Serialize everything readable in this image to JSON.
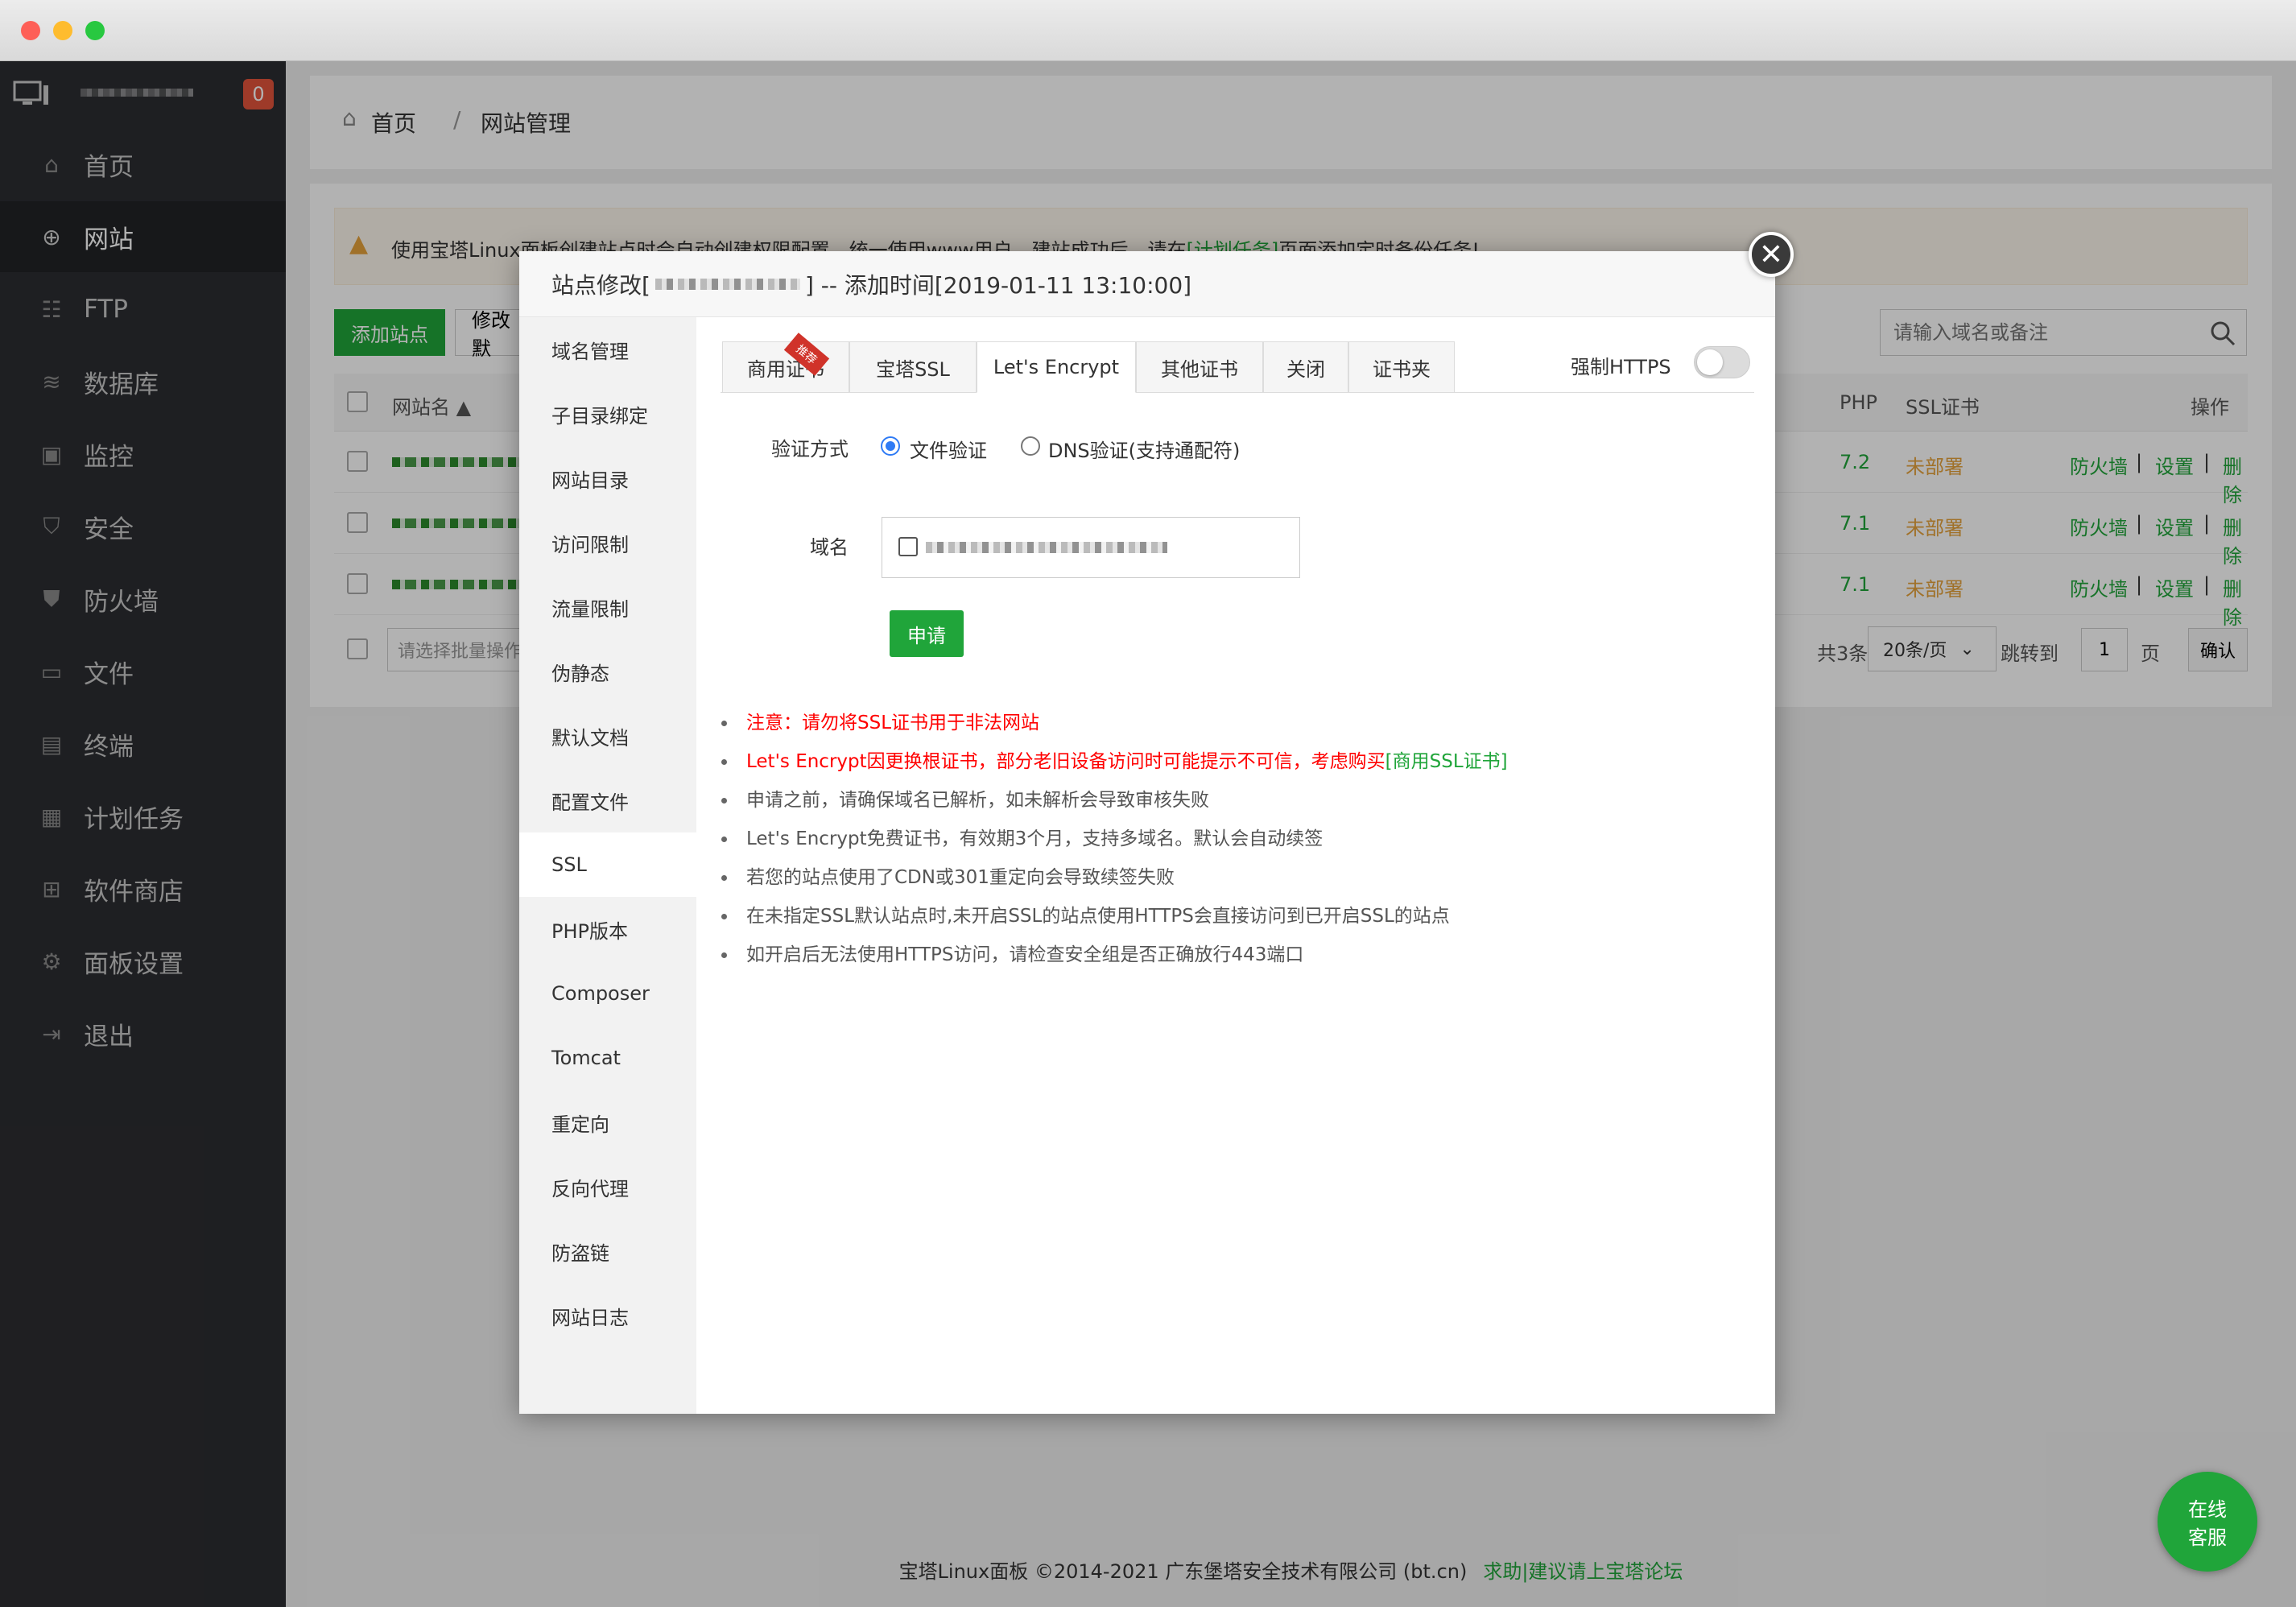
{
  "breadcrumb": {
    "home": "首页",
    "sep": "/",
    "current": "网站管理"
  },
  "sidebar": {
    "badge": "0",
    "items": [
      {
        "label": "首页",
        "icon": "home-icon"
      },
      {
        "label": "网站",
        "icon": "globe-icon"
      },
      {
        "label": "FTP",
        "icon": "ftp-icon"
      },
      {
        "label": "数据库",
        "icon": "database-icon"
      },
      {
        "label": "监控",
        "icon": "monitor-icon"
      },
      {
        "label": "安全",
        "icon": "shield-icon"
      },
      {
        "label": "防火墙",
        "icon": "firewall-icon"
      },
      {
        "label": "文件",
        "icon": "folder-icon"
      },
      {
        "label": "终端",
        "icon": "terminal-icon"
      },
      {
        "label": "计划任务",
        "icon": "calendar-icon"
      },
      {
        "label": "软件商店",
        "icon": "apps-icon"
      },
      {
        "label": "面板设置",
        "icon": "gear-icon"
      },
      {
        "label": "退出",
        "icon": "logout-icon"
      }
    ]
  },
  "warning": {
    "text": "使用宝塔Linux面板创建站点时会自动创建权限配置，统一使用www用户。建站成功后，请在",
    "link": "[计划任务]",
    "tail": "页面添加定时备份任务!"
  },
  "toolbar": {
    "add_site": "添加站点",
    "modify": "修改默",
    "search_placeholder": "请输入域名或备注"
  },
  "table": {
    "headers": {
      "name": "网站名",
      "php": "PHP",
      "ssl": "SSL证书",
      "ops": "操作"
    },
    "rows": [
      {
        "php": "7.2",
        "ssl": "未部署",
        "firewall": "防火墙",
        "settings": "设置",
        "delete": "删除"
      },
      {
        "php": "7.1",
        "ssl": "未部署",
        "firewall": "防火墙",
        "settings": "设置",
        "delete": "删除"
      },
      {
        "php": "7.1",
        "ssl": "未部署",
        "firewall": "防火墙",
        "settings": "设置",
        "delete": "删除"
      }
    ],
    "batch_placeholder": "请选择批量操作",
    "total": "共3条",
    "page_size": "20条/页",
    "jump_label": "跳转到",
    "jump_value": "1",
    "page_unit": "页",
    "confirm": "确认"
  },
  "modal": {
    "title_prefix": "站点修改[",
    "title_suffix": "] -- 添加时间[2019-01-11 13:10:00]",
    "nav": [
      "域名管理",
      "子目录绑定",
      "网站目录",
      "访问限制",
      "流量限制",
      "伪静态",
      "默认文档",
      "配置文件",
      "SSL",
      "PHP版本",
      "Composer",
      "Tomcat",
      "重定向",
      "反向代理",
      "防盗链",
      "网站日志"
    ],
    "tabs": [
      "商用证书",
      "宝塔SSL",
      "Let's Encrypt",
      "其他证书",
      "关闭",
      "证书夹"
    ],
    "ribbon": "推荐",
    "force_https": "强制HTTPS",
    "verify_label": "验证方式",
    "verify_file": "文件验证",
    "verify_dns": "DNS验证(支持通配符)",
    "domain_label": "域名",
    "apply": "申请",
    "notes": [
      {
        "text": "注意：请勿将SSL证书用于非法网站",
        "color": "#ff0000"
      },
      {
        "text": "Let's Encrypt因更换根证书，部分老旧设备访问时可能提示不可信，考虑购买",
        "link": "[商用SSL证书]",
        "color": "#ff0000"
      },
      {
        "text": "申请之前，请确保域名已解析，如未解析会导致审核失败",
        "color": "#555555"
      },
      {
        "text": "Let's Encrypt免费证书，有效期3个月，支持多域名。默认会自动续签",
        "color": "#555555"
      },
      {
        "text": "若您的站点使用了CDN或301重定向会导致续签失败",
        "color": "#555555"
      },
      {
        "text": "在未指定SSL默认站点时,未开启SSL的站点使用HTTPS会直接访问到已开启SSL的站点",
        "color": "#555555"
      },
      {
        "text": "如开启后无法使用HTTPS访问，请检查安全组是否正确放行443端口",
        "color": "#555555"
      }
    ]
  },
  "footer": {
    "text": "宝塔Linux面板 ©2014-2021 广东堡塔安全技术有限公司 (bt.cn)",
    "link": "求助|建议请上宝塔论坛"
  },
  "chat_button": {
    "line1": "在线",
    "line2": "客服"
  },
  "colors": {
    "accent": "#20a53a",
    "sidebar": "#2c2d31",
    "warning": "#e6a23c",
    "danger": "#ff0000"
  }
}
